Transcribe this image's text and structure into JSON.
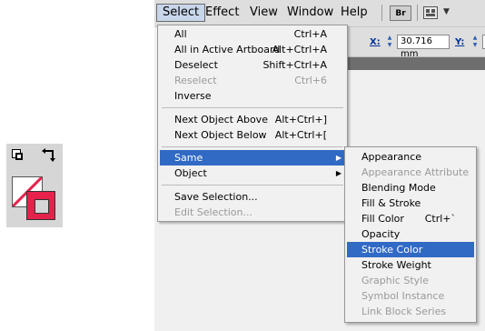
{
  "menubar": {
    "items": [
      {
        "label": "Select",
        "active": true
      },
      {
        "label": "Effect",
        "active": false
      },
      {
        "label": "View",
        "active": false
      },
      {
        "label": "Window",
        "active": false
      },
      {
        "label": "Help",
        "active": false
      }
    ],
    "bridge_button": "Br",
    "workspace_icon": "workspace-grid-icon"
  },
  "control_bar": {
    "x_label": "X:",
    "x_value": "30.716 mm",
    "y_label": "Y:"
  },
  "tool_panel": {
    "fill_color": "#ffffff",
    "stroke_color": "#e6214b",
    "icons": [
      "default-fill-stroke-icon",
      "swap-fill-stroke-icon"
    ]
  },
  "select_menu": {
    "items": [
      {
        "label": "All",
        "shortcut": "Ctrl+A",
        "disabled": false
      },
      {
        "label": "All in Active Artboard",
        "shortcut": "Alt+Ctrl+A",
        "disabled": false
      },
      {
        "label": "Deselect",
        "shortcut": "Shift+Ctrl+A",
        "disabled": false
      },
      {
        "label": "Reselect",
        "shortcut": "Ctrl+6",
        "disabled": true
      },
      {
        "label": "Inverse",
        "shortcut": "",
        "disabled": false
      },
      {
        "label": "Next Object Above",
        "shortcut": "Alt+Ctrl+]",
        "disabled": false
      },
      {
        "label": "Next Object Below",
        "shortcut": "Alt+Ctrl+[",
        "disabled": false
      },
      {
        "label": "Same",
        "shortcut": "",
        "disabled": false,
        "submenu": true,
        "highlighted": true
      },
      {
        "label": "Object",
        "shortcut": "",
        "disabled": false,
        "submenu": true
      },
      {
        "label": "Save Selection...",
        "shortcut": "",
        "disabled": false
      },
      {
        "label": "Edit Selection...",
        "shortcut": "",
        "disabled": true
      }
    ]
  },
  "same_submenu": {
    "items": [
      {
        "label": "Appearance",
        "shortcut": "",
        "disabled": false
      },
      {
        "label": "Appearance Attribute",
        "shortcut": "",
        "disabled": true
      },
      {
        "label": "Blending Mode",
        "shortcut": "",
        "disabled": false
      },
      {
        "label": "Fill & Stroke",
        "shortcut": "",
        "disabled": false
      },
      {
        "label": "Fill Color",
        "shortcut": "Ctrl+`",
        "disabled": false
      },
      {
        "label": "Opacity",
        "shortcut": "",
        "disabled": false
      },
      {
        "label": "Stroke Color",
        "shortcut": "",
        "disabled": false,
        "highlighted": true
      },
      {
        "label": "Stroke Weight",
        "shortcut": "",
        "disabled": false
      },
      {
        "label": "Graphic Style",
        "shortcut": "",
        "disabled": true
      },
      {
        "label": "Symbol Instance",
        "shortcut": "",
        "disabled": true
      },
      {
        "label": "Link Block Series",
        "shortcut": "",
        "disabled": true
      }
    ]
  },
  "colors": {
    "highlight": "#316ac5",
    "menu_bg": "#f1f1f1",
    "disabled_text": "#9a9a9a"
  }
}
